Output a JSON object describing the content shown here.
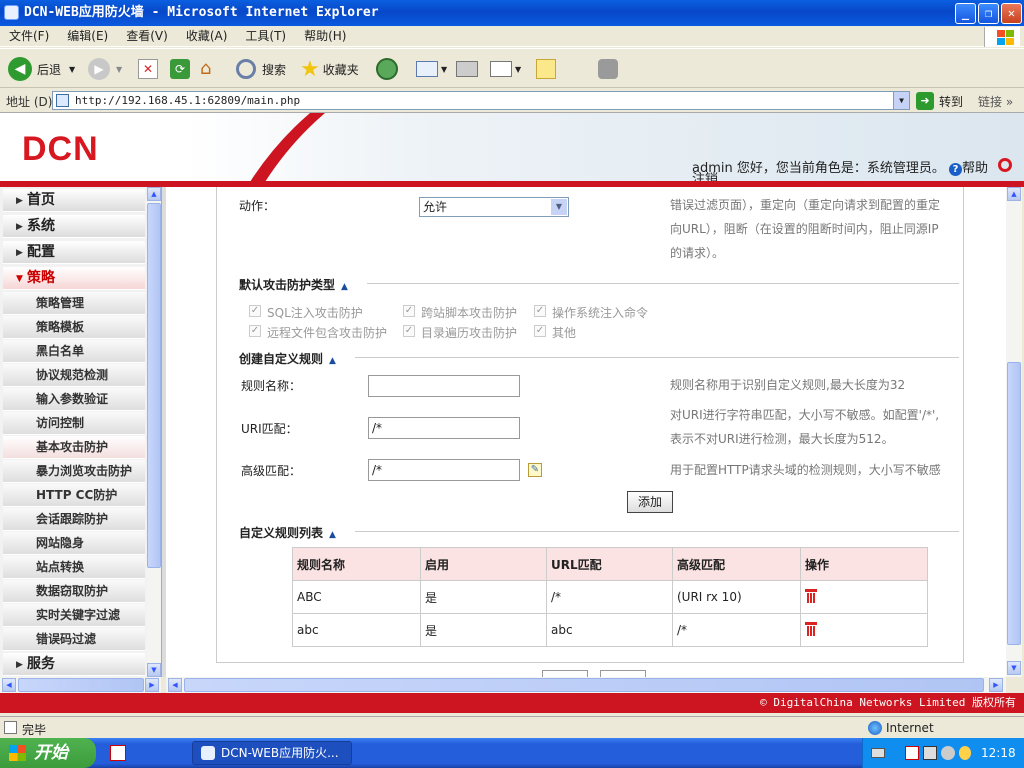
{
  "window": {
    "title": "DCN-WEB应用防火墙 - Microsoft Internet Explorer"
  },
  "menu": [
    "文件(F)",
    "编辑(E)",
    "查看(V)",
    "收藏(A)",
    "工具(T)",
    "帮助(H)"
  ],
  "toolbar": {
    "back": "后退",
    "search": "搜索",
    "favorites": "收藏夹"
  },
  "address": {
    "label": "地址 (D)",
    "url": "http://192.168.45.1:62809/main.php",
    "go": "转到",
    "links": "链接"
  },
  "header": {
    "logo": "DCN",
    "user": "admin",
    "greeting": "您好，您当前角色是：系统管理员。",
    "help": "帮助",
    "logout": "注销"
  },
  "nav": {
    "top": [
      {
        "label": "首页"
      },
      {
        "label": "系统"
      },
      {
        "label": "配置"
      },
      {
        "label": "策略"
      }
    ],
    "sub": [
      "策略管理",
      "策略模板",
      "黑白名单",
      "协议规范检测",
      "输入参数验证",
      "访问控制",
      "基本攻击防护",
      "暴力浏览攻击防护",
      "HTTP CC防护",
      "会话跟踪防护",
      "网站隐身",
      "站点转换",
      "数据窃取防护",
      "实时关键字过滤",
      "错误码过滤"
    ],
    "bottom": "服务"
  },
  "form": {
    "action_label": "动作：",
    "action_value": "允许",
    "action_hint": [
      "错误过滤页面），重定向（重定向请求到配置的重定",
      "向URL），阻断（在设置的阻断时间内，阻止同源IP",
      "的请求）。"
    ],
    "default_section": "默认攻击防护类型",
    "checks": [
      "SQL注入攻击防护",
      "跨站脚本攻击防护",
      "操作系统注入命令",
      "远程文件包含攻击防护",
      "目录遍历攻击防护",
      "其他"
    ],
    "custom_section": "创建自定义规则",
    "rule_name_label": "规则名称：",
    "rule_name_value": "",
    "rule_name_hint": "规则名称用于识别自定义规则,最大长度为32",
    "uri_label": "URI匹配：",
    "uri_value": "/*",
    "uri_hint": [
      "对URI进行字符串匹配，大小写不敏感。如配置'/*',",
      "表示不对URI进行检测，最大长度为512。"
    ],
    "adv_label": "高级匹配：",
    "adv_value": "/*",
    "adv_hint": "用于配置HTTP请求头域的检测规则，大小写不敏感",
    "add_button": "添加",
    "list_section": "自定义规则列表",
    "caret": "▲"
  },
  "table": {
    "headers": [
      "规则名称",
      "启用",
      "URL匹配",
      "高级匹配",
      "操作"
    ],
    "rows": [
      [
        "ABC",
        "是",
        "/*",
        "(URI rx 10)"
      ],
      [
        "abc",
        "是",
        "abc",
        "/*"
      ]
    ]
  },
  "footer": "© DigitalChina Networks Limited 版权所有",
  "status": {
    "done": "完毕",
    "zone": "Internet"
  },
  "taskbar": {
    "start": "开始",
    "task": "DCN-WEB应用防火...",
    "clock": "12:18"
  }
}
